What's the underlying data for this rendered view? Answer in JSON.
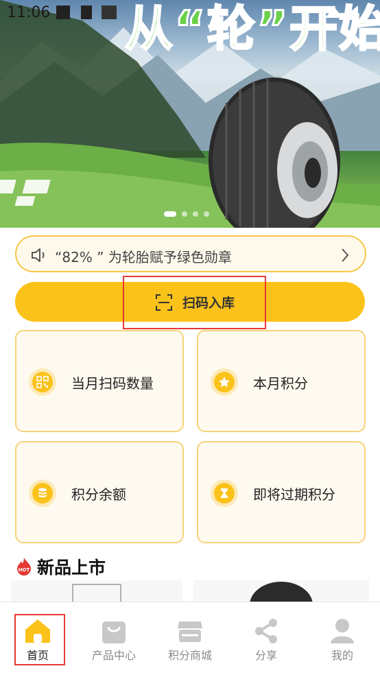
{
  "status_bar": {
    "time": "11:06"
  },
  "banner": {
    "title": "从“轮”开始",
    "slides_count": 4,
    "active_slide": 0
  },
  "notice": {
    "text": "“82% ” 为轮胎赋予绿色勋章",
    "icon": "speaker-icon",
    "chevron": "chevron-right-icon"
  },
  "scan_button": {
    "label": "扫码入库",
    "icon": "scan-icon"
  },
  "cards": [
    {
      "label": "当月扫码数量",
      "icon": "qr-code-icon"
    },
    {
      "label": "本月积分",
      "icon": "star-icon"
    },
    {
      "label": "积分余额",
      "icon": "coins-icon"
    },
    {
      "label": "即将过期积分",
      "icon": "hourglass-icon"
    }
  ],
  "new_products": {
    "title": "新品上市",
    "badge": "HOT"
  },
  "tabbar": {
    "items": [
      {
        "label": "首页",
        "icon": "home-icon",
        "active": true
      },
      {
        "label": "产品中心",
        "icon": "shopping-bag-icon",
        "active": false
      },
      {
        "label": "积分商城",
        "icon": "store-icon",
        "active": false
      },
      {
        "label": "分享",
        "icon": "share-icon",
        "active": false
      },
      {
        "label": "我的",
        "icon": "user-icon",
        "active": false
      }
    ]
  },
  "colors": {
    "accent": "#fbc21a",
    "card_border": "#f6d27a",
    "highlight": "#e53935"
  }
}
